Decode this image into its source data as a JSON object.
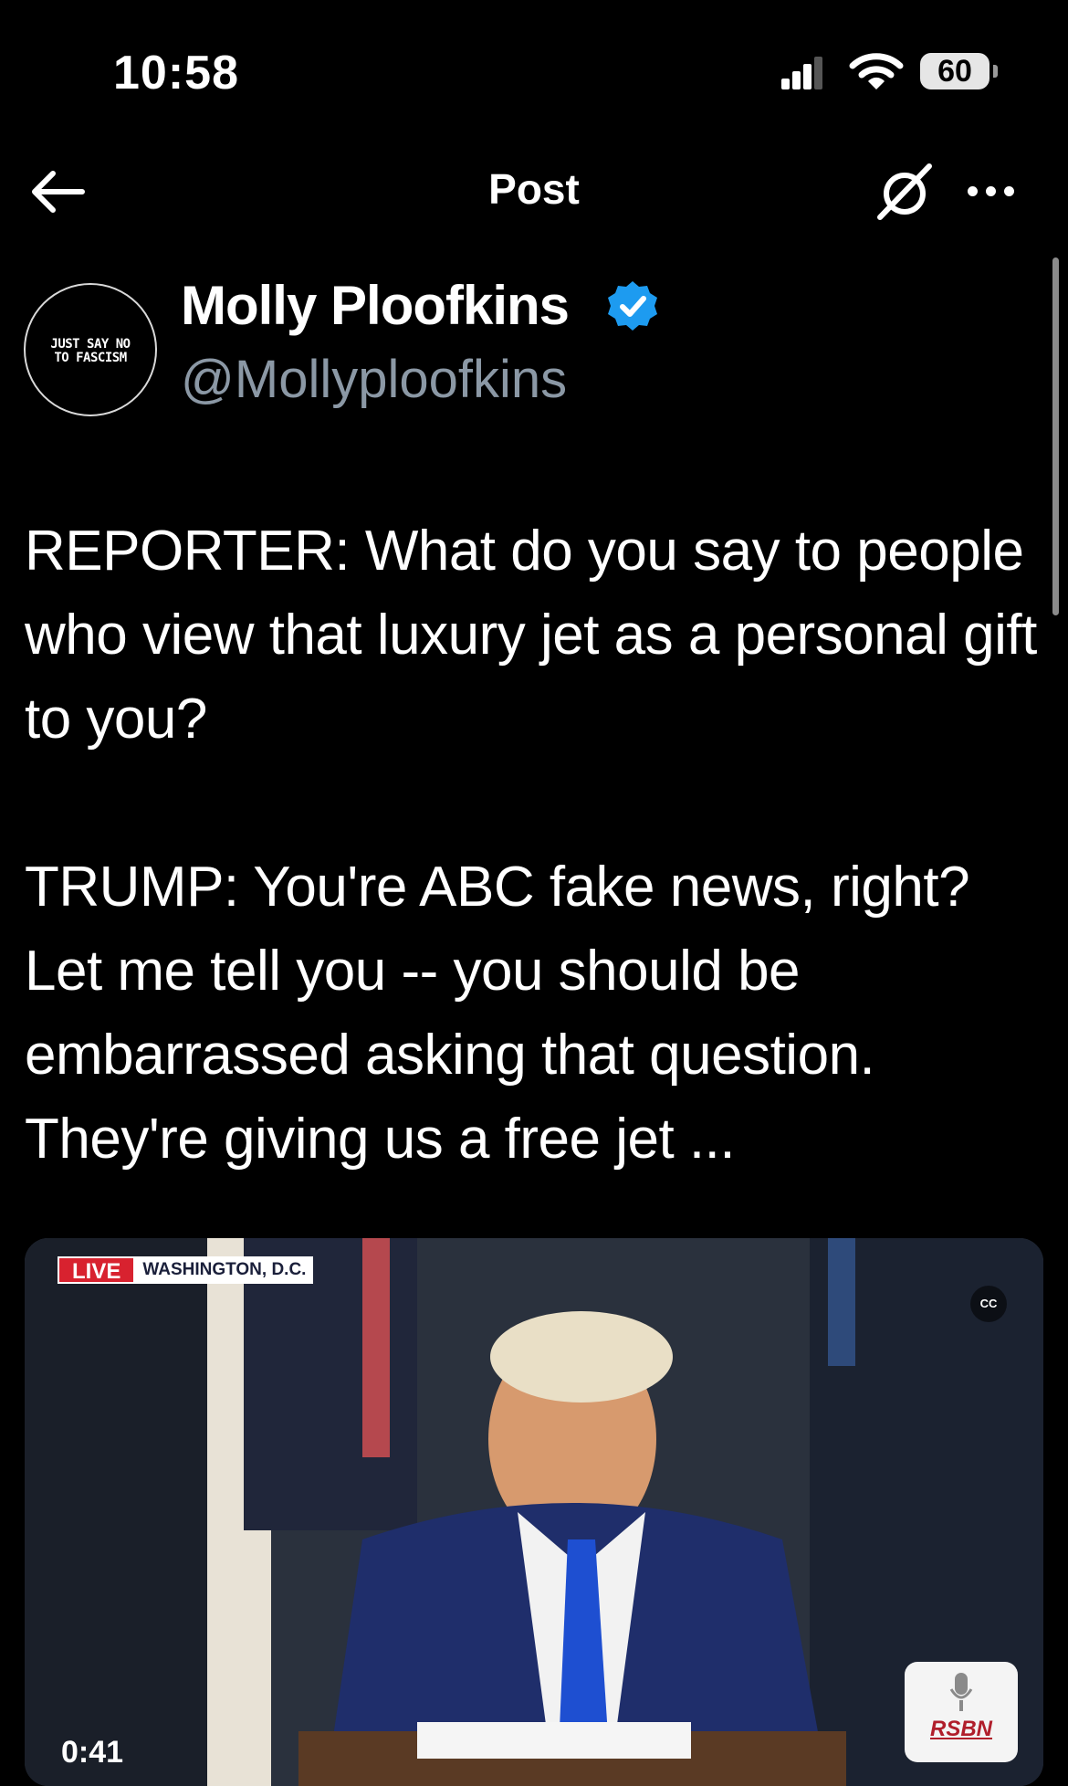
{
  "status_bar": {
    "time": "10:58",
    "battery": "60"
  },
  "header": {
    "title": "Post",
    "back_icon": "arrow-left-icon",
    "grok_icon": "grok-icon",
    "more_icon": "more-horizontal-icon"
  },
  "author": {
    "avatar_text_line1": "JUST SAY NO",
    "avatar_text_line2": "TO FASCISM",
    "name": "Molly Ploofkins",
    "handle": "@Mollyploofkins",
    "verified_color": "#1d9bf0"
  },
  "post": {
    "paragraph1": "REPORTER: What do you say to people who view that luxury jet as a personal gift to you?",
    "paragraph2": "TRUMP: You're ABC fake news, right? Let me tell you -- you should be embarrassed asking that question. They're giving us a free jet ..."
  },
  "video": {
    "live_label": "LIVE",
    "location": "WASHINGTON, D.C.",
    "cc_label": "CC",
    "network_logo": "RSBN",
    "timecode": "0:41"
  }
}
